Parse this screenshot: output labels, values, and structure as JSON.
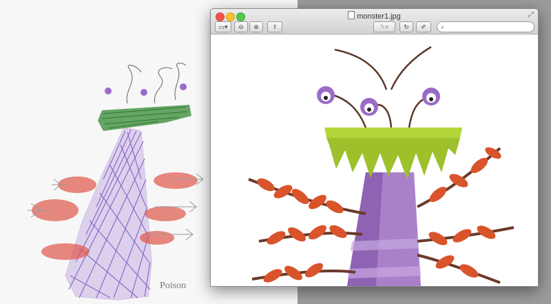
{
  "window": {
    "title": "monster1.jpg"
  },
  "drawing": {
    "caption": "Poison"
  },
  "toolbar": {
    "buttons": [
      {
        "name": "sidebar",
        "icon": "sidebar-icon"
      },
      {
        "name": "zoom-out",
        "icon": "zoom-out-icon"
      },
      {
        "name": "zoom-in",
        "icon": "zoom-in-icon"
      },
      {
        "name": "share",
        "icon": "share-icon"
      },
      {
        "name": "markup-pen",
        "icon": "pen-icon"
      },
      {
        "name": "rotate",
        "icon": "rotate-icon"
      },
      {
        "name": "edit",
        "icon": "edit-icon"
      }
    ],
    "search_placeholder": ""
  },
  "colors": {
    "crayon_purple": "#7b4fc0",
    "crayon_green": "#2f8a3a",
    "crayon_red": "#e0584c",
    "monster_purple": "#a981c9",
    "monster_green": "#b5d63a",
    "leaf_orange": "#d9532b"
  }
}
